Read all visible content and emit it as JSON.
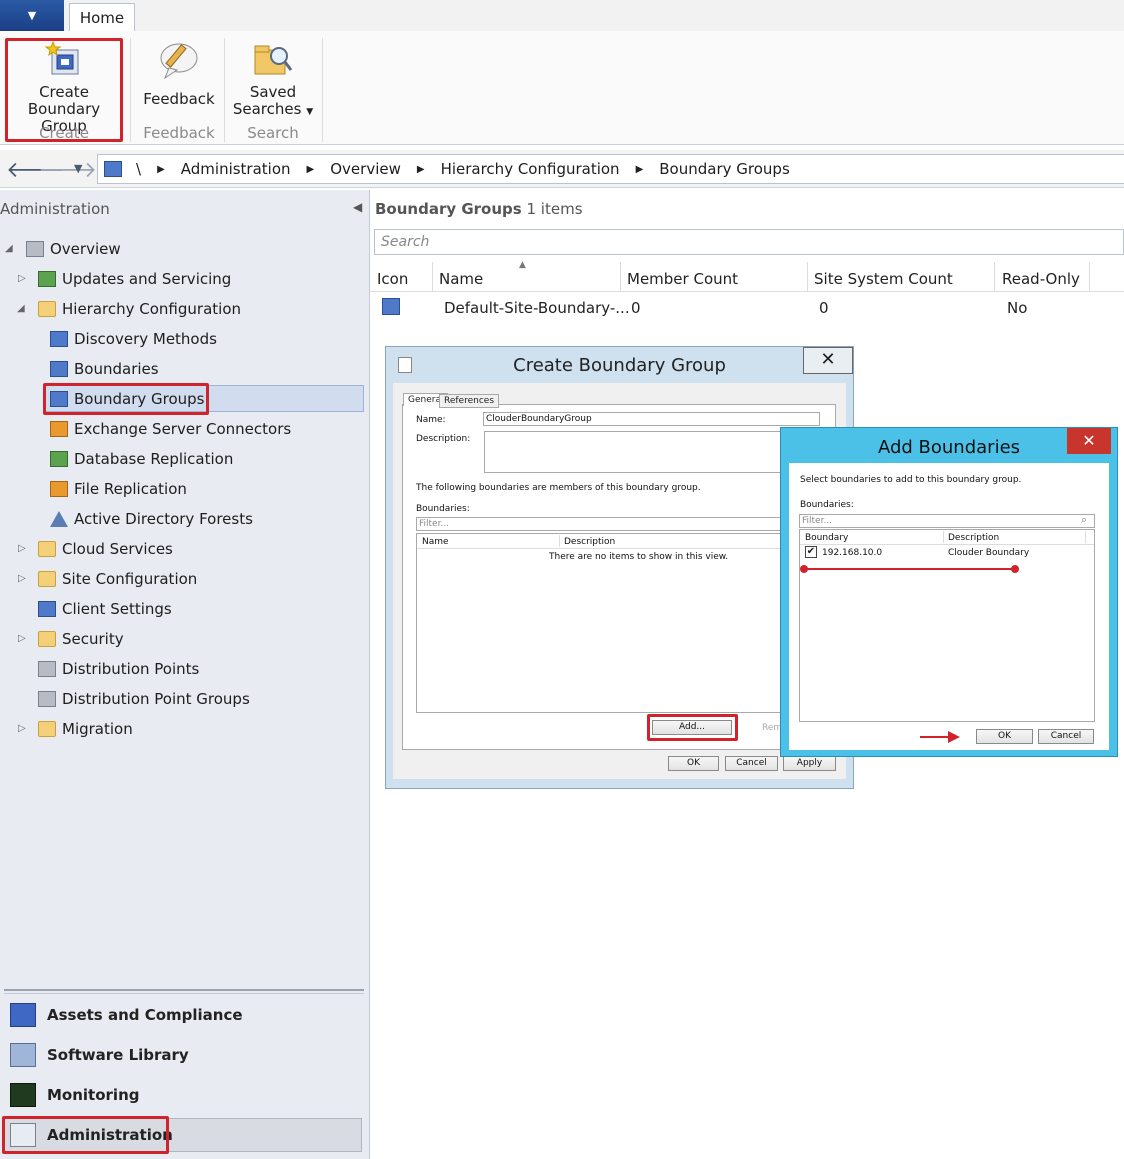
{
  "app_menu": {
    "icon": "chevron-down-icon"
  },
  "ribbon": {
    "tab_home": "Home",
    "buttons": {
      "create_boundary_group": {
        "line1": "Create",
        "line2": "Boundary Group",
        "icon": "create-boundary-group-icon"
      },
      "feedback": {
        "label": "Feedback",
        "icon": "feedback-icon"
      },
      "saved_searches": {
        "line1": "Saved",
        "line2": "Searches",
        "icon": "saved-searches-icon"
      }
    },
    "groups": {
      "create": "Create",
      "feedback": "Feedback",
      "search": "Search"
    }
  },
  "address_bar": {
    "root": "\\",
    "breadcrumbs": [
      "Administration",
      "Overview",
      "Hierarchy Configuration",
      "Boundary Groups"
    ]
  },
  "left_pane": {
    "title": "Administration",
    "tree": [
      {
        "label": "Overview"
      },
      {
        "label": "Updates and Servicing"
      },
      {
        "label": "Hierarchy Configuration"
      },
      {
        "label": "Discovery Methods"
      },
      {
        "label": "Boundaries"
      },
      {
        "label": "Boundary Groups"
      },
      {
        "label": "Exchange Server Connectors"
      },
      {
        "label": "Database Replication"
      },
      {
        "label": "File Replication"
      },
      {
        "label": "Active Directory Forests"
      },
      {
        "label": "Cloud Services"
      },
      {
        "label": "Site Configuration"
      },
      {
        "label": "Client Settings"
      },
      {
        "label": "Security"
      },
      {
        "label": "Distribution Points"
      },
      {
        "label": "Distribution Point Groups"
      },
      {
        "label": "Migration"
      }
    ],
    "workspaces": [
      {
        "label": "Assets and Compliance"
      },
      {
        "label": "Software Library"
      },
      {
        "label": "Monitoring"
      },
      {
        "label": "Administration"
      }
    ]
  },
  "right_pane": {
    "title": "Boundary Groups",
    "count": "1 items",
    "search_placeholder": "Search",
    "columns": [
      "Icon",
      "Name",
      "Member Count",
      "Site System Count",
      "Read-Only"
    ],
    "rows": [
      {
        "name": "Default-Site-Boundary-...",
        "member_count": "0",
        "site_system_count": "0",
        "read_only": "No"
      }
    ]
  },
  "dialog_create": {
    "title": "Create Boundary Group",
    "close": "✕",
    "tabs": [
      "General",
      "References"
    ],
    "name_label": "Name:",
    "name_value": "ClouderBoundaryGroup",
    "description_label": "Description:",
    "members_text": "The following boundaries are members of this boundary group.",
    "boundaries_label": "Boundaries:",
    "filter_placeholder": "Filter...",
    "columns": [
      "Name",
      "Description"
    ],
    "empty_text": "There are no items to show in this view.",
    "add_button": "Add...",
    "remove_button": "Rem",
    "ok": "OK",
    "cancel": "Cancel",
    "apply": "Apply"
  },
  "dialog_add": {
    "title": "Add Boundaries",
    "close": "✕",
    "instruction": "Select boundaries to add to this boundary group.",
    "boundaries_label": "Boundaries:",
    "filter_placeholder": "Filter...",
    "columns": [
      "Boundary",
      "Description"
    ],
    "rows": [
      {
        "boundary": "192.168.10.0",
        "description": "Clouder Boundary",
        "checked": true
      }
    ],
    "ok": "OK",
    "cancel": "Cancel"
  },
  "colors": {
    "highlight": "#d0232b",
    "dialog_accent": "#4cc1e8",
    "selection": "#d2dcef"
  }
}
